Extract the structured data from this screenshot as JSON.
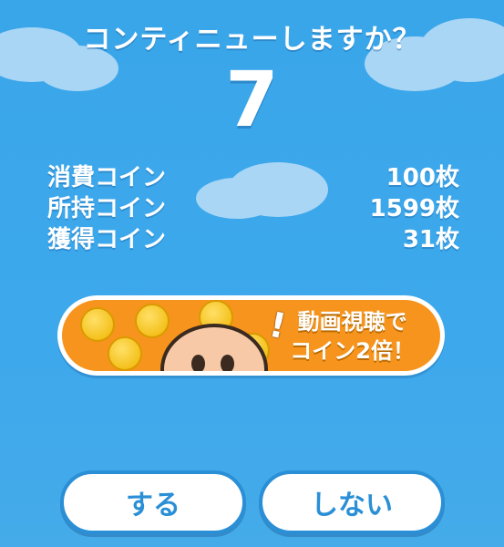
{
  "title": "コンティニューしますか？",
  "countdown": "7",
  "stats": {
    "consumed": {
      "label": "消費コイン",
      "value": "100枚"
    },
    "owned": {
      "label": "所持コイン",
      "value": "1599枚"
    },
    "earned": {
      "label": "獲得コイン",
      "value": "31枚"
    }
  },
  "banner": {
    "line1": "動画視聴で",
    "line2": "コイン2倍！",
    "exclaim": "!"
  },
  "buttons": {
    "yes": "する",
    "no": "しない"
  },
  "colors": {
    "sky": "#3da8ec",
    "banner": "#f7941d",
    "button_text": "#2a8fd6"
  }
}
